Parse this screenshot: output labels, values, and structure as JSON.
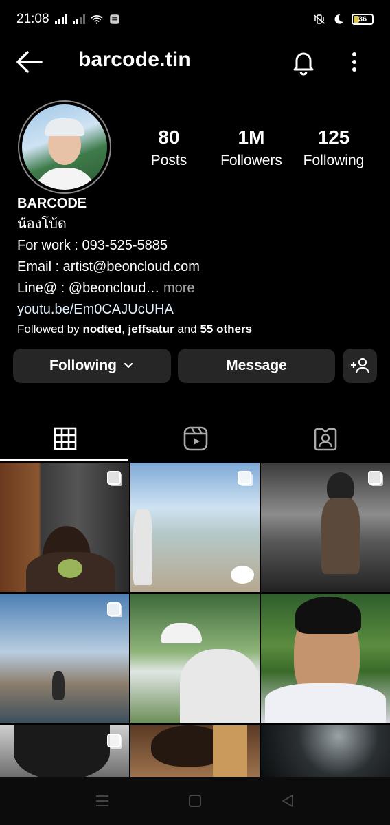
{
  "status_bar": {
    "time": "21:08",
    "battery": "36"
  },
  "header": {
    "username": "barcode.tin"
  },
  "profile": {
    "stats": [
      {
        "value": "80",
        "label": "Posts"
      },
      {
        "value": "1M",
        "label": "Followers"
      },
      {
        "value": "125",
        "label": "Following"
      }
    ],
    "display_name": "BARCODE",
    "nickname": "น้องโบ้ด",
    "work": "For work : 093-525-5885",
    "email": "Email : artist@beoncloud.com",
    "line": "Line@ : @beoncloud…",
    "more": "more",
    "link": "youtu.be/Em0CAJUcUHA",
    "followed_prefix": "Followed by ",
    "followed_user1": "nodted",
    "followed_sep": ", ",
    "followed_user2": "jeffsatur",
    "followed_and": " and ",
    "followed_others": "55 others"
  },
  "actions": {
    "following_label": "Following",
    "message_label": "Message"
  },
  "tabs": [
    "grid-icon",
    "reels-icon",
    "tagged-icon"
  ],
  "grid_posts": [
    {
      "multi": true
    },
    {
      "multi": true
    },
    {
      "multi": true
    },
    {
      "multi": true
    },
    {
      "multi": false
    },
    {
      "multi": false
    },
    {
      "multi": true
    },
    {
      "multi": false
    },
    {
      "multi": false
    }
  ],
  "colors": {
    "background": "#000000",
    "button": "#262626",
    "muted": "#a8a8a8"
  }
}
